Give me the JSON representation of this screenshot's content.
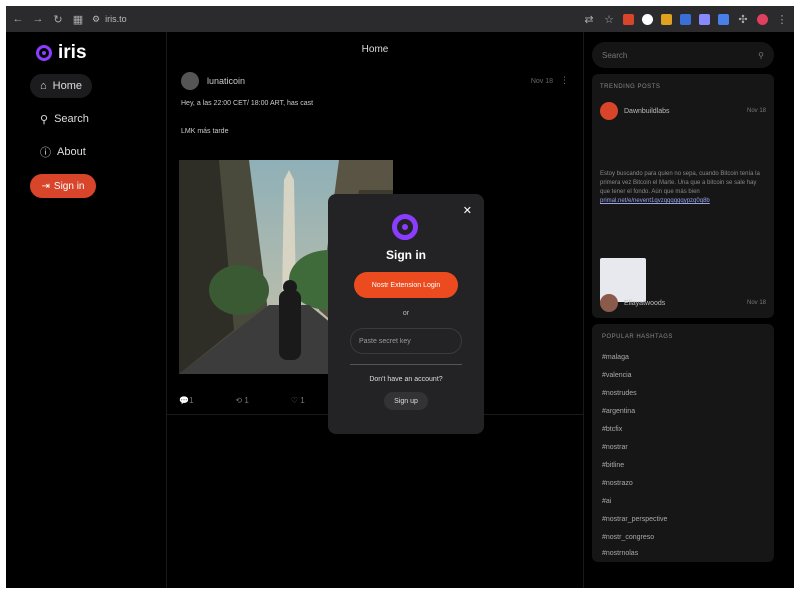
{
  "browser": {
    "url": "iris.to"
  },
  "sidebar": {
    "logo": "iris",
    "items": [
      {
        "label": "Home",
        "icon": "home-icon"
      },
      {
        "label": "Search",
        "icon": "search-icon"
      },
      {
        "label": "About",
        "icon": "info-icon"
      }
    ],
    "sign_in_label": "Sign in"
  },
  "feed": {
    "title": "Home",
    "post": {
      "author": "lunaticoin",
      "time": "Nov 18",
      "text_line1": "Hey, a las 22:00 CET/ 18:00 ART, has cast",
      "text_line2": "LMK más tarde",
      "actions": {
        "replies": "1",
        "reposts": "1",
        "likes": "1"
      }
    }
  },
  "right": {
    "search_placeholder": "Search",
    "trending_title": "Trending posts",
    "trending_post": {
      "author": "Dawnbuildlabs",
      "time": "Nov 18",
      "text": "Estoy buscando para quien no sepa, cuando Bitcoin tenía la primera vez Bitcoin el Marte. Una que a bitcoin se sale hay que tener el fondo. Aún que más bien ",
      "link": "primal.net/e/nevent1qvzqqqqqqypzq0q8b"
    },
    "second_author": "Ellayatwoods",
    "second_time": "Nov 18",
    "hashtags_title": "Popular hashtags",
    "hashtags": [
      "#malaga",
      "#valencia",
      "#nostrudes",
      "#argentina",
      "#btcfix",
      "#nostrar",
      "#bitline",
      "#nostrazo",
      "#ai",
      "#nostrar_perspective",
      "#nostr_congreso",
      "#nostrnolas"
    ]
  },
  "modal": {
    "title": "Sign in",
    "extension_login": "Nostr Extension Login",
    "or": "or",
    "secret_placeholder": "Paste secret key",
    "no_account": "Don't have an account?",
    "sign_up": "Sign up",
    "close": "✕"
  }
}
